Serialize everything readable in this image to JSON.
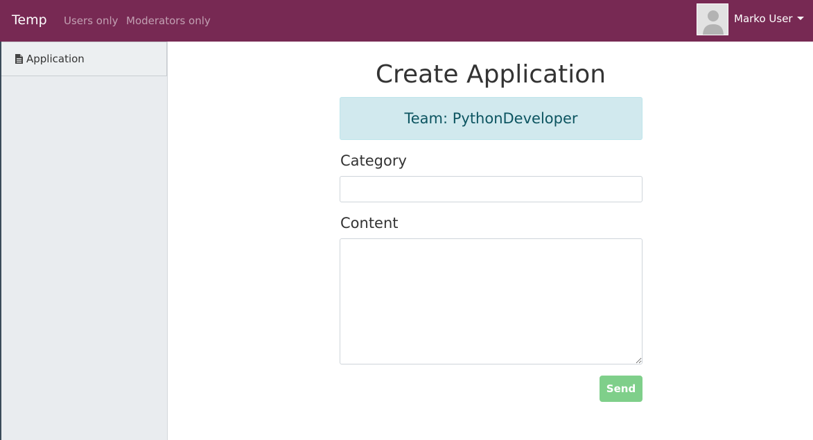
{
  "navbar": {
    "brand": "Temp",
    "links": [
      "Users only",
      "Moderators only"
    ],
    "user_name": "Marko User",
    "avatar_icon": "default-avatar-icon",
    "background_color": "#772953"
  },
  "sidebar": {
    "items": [
      {
        "label": "Application",
        "icon": "file-text-icon"
      }
    ]
  },
  "main": {
    "title": "Create Application",
    "team_alert": "Team: PythonDeveloper",
    "form": {
      "category_label": "Category",
      "category_value": "",
      "content_label": "Content",
      "content_value": "",
      "submit_label": "Send",
      "submit_color": "#7fcf8a"
    }
  }
}
